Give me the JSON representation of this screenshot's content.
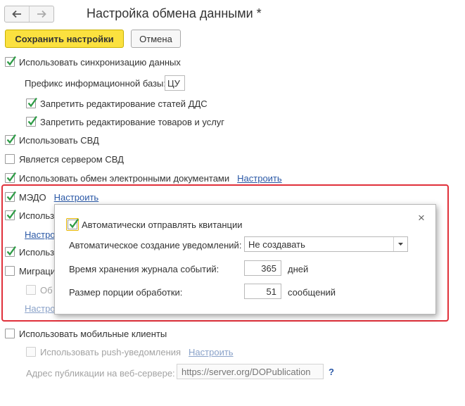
{
  "header": {
    "title": "Настройка обмена данными *"
  },
  "toolbar": {
    "save_label": "Сохранить настройки",
    "cancel_label": "Отмена"
  },
  "main": {
    "use_sync": {
      "label": "Использовать синхронизацию данных",
      "checked": true
    },
    "prefix_label": "Префикс информационной базы:",
    "prefix_value": "ЦУ",
    "forbid_dds": {
      "label": "Запретить редактирование статей ДДС",
      "checked": true
    },
    "forbid_goods": {
      "label": "Запретить редактирование товаров и услуг",
      "checked": true
    },
    "use_svd": {
      "label": "Использовать СВД",
      "checked": true
    },
    "is_svd_server": {
      "label": "Является сервером СВД",
      "checked": false
    },
    "use_edo": {
      "label": "Использовать обмен электронными документами",
      "checked": true,
      "link": "Настроить"
    },
    "medo": {
      "label": "МЭДО",
      "checked": true,
      "link": "Настроить"
    },
    "hidden_row_1": {
      "label": "Использ",
      "checked": true,
      "link": "Настро"
    },
    "hidden_row_2": {
      "label": "Использ",
      "checked": true
    },
    "migration": {
      "label": "Миграци",
      "checked": false,
      "sub_label": "Об",
      "link": "Настро"
    },
    "use_mobile": {
      "label": "Использовать мобильные клиенты",
      "checked": false
    },
    "use_push": {
      "label": "Использовать push-уведомления",
      "checked": false,
      "link": "Настроить"
    },
    "publication_label": "Адрес публикации на веб-сервере:",
    "publication_placeholder": "https://server.org/DOPublication",
    "help_label": "?"
  },
  "popup": {
    "auto_send": {
      "label": "Автоматически отправлять квитанции",
      "checked": true
    },
    "auto_notify_label": "Автоматическое создание уведомлений:",
    "auto_notify_value": "Не создавать",
    "log_label": "Время хранения журнала событий:",
    "log_value": "365",
    "log_unit": "дней",
    "portion_label": "Размер порции обработки:",
    "portion_value": "51",
    "portion_unit": "сообщений",
    "close_label": "×"
  },
  "colors": {
    "accent_button": "#fbe13f",
    "link": "#2a58a6",
    "highlight_border": "#e0303a",
    "check": "#2e9c46"
  }
}
